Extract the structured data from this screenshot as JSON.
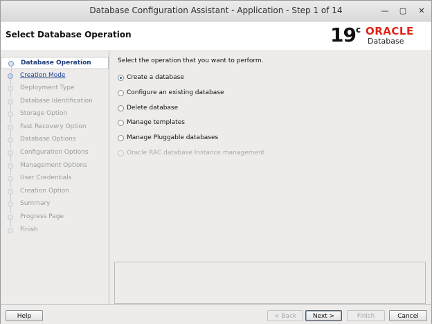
{
  "window": {
    "title": "Database Configuration Assistant - Application - Step 1 of 14",
    "min_glyph": "—",
    "max_glyph": "▢",
    "close_glyph": "✕"
  },
  "header": {
    "page_title": "Select Database Operation",
    "logo_version": "19",
    "logo_sup": "c",
    "logo_brand": "ORACLE",
    "logo_product": "Database",
    "brand_color": "#e0231a"
  },
  "steps": [
    {
      "label": "Database Operation",
      "state": "active"
    },
    {
      "label": "Creation Mode",
      "state": "next"
    },
    {
      "label": "Deployment Type",
      "state": "disabled"
    },
    {
      "label": "Database Identification",
      "state": "disabled"
    },
    {
      "label": "Storage Option",
      "state": "disabled"
    },
    {
      "label": "Fast Recovery Option",
      "state": "disabled"
    },
    {
      "label": "Database Options",
      "state": "disabled"
    },
    {
      "label": "Configuration Options",
      "state": "disabled"
    },
    {
      "label": "Management Options",
      "state": "disabled"
    },
    {
      "label": "User Credentials",
      "state": "disabled"
    },
    {
      "label": "Creation Option",
      "state": "disabled"
    },
    {
      "label": "Summary",
      "state": "disabled"
    },
    {
      "label": "Progress Page",
      "state": "disabled"
    },
    {
      "label": "Finish",
      "state": "disabled"
    }
  ],
  "content": {
    "prompt": "Select the operation that you want to perform.",
    "options": [
      {
        "label": "Create a database",
        "checked": true,
        "disabled": false
      },
      {
        "label": "Configure an existing database",
        "checked": false,
        "disabled": false
      },
      {
        "label": "Delete database",
        "checked": false,
        "disabled": false
      },
      {
        "label": "Manage templates",
        "checked": false,
        "disabled": false
      },
      {
        "label": "Manage Pluggable databases",
        "checked": false,
        "disabled": false
      },
      {
        "label": "Oracle RAC database Instance management",
        "checked": false,
        "disabled": true
      }
    ]
  },
  "footer": {
    "help_label": "Help",
    "back_label": "< Back",
    "next_label": "Next >",
    "finish_label": "Finish",
    "cancel_label": "Cancel"
  }
}
